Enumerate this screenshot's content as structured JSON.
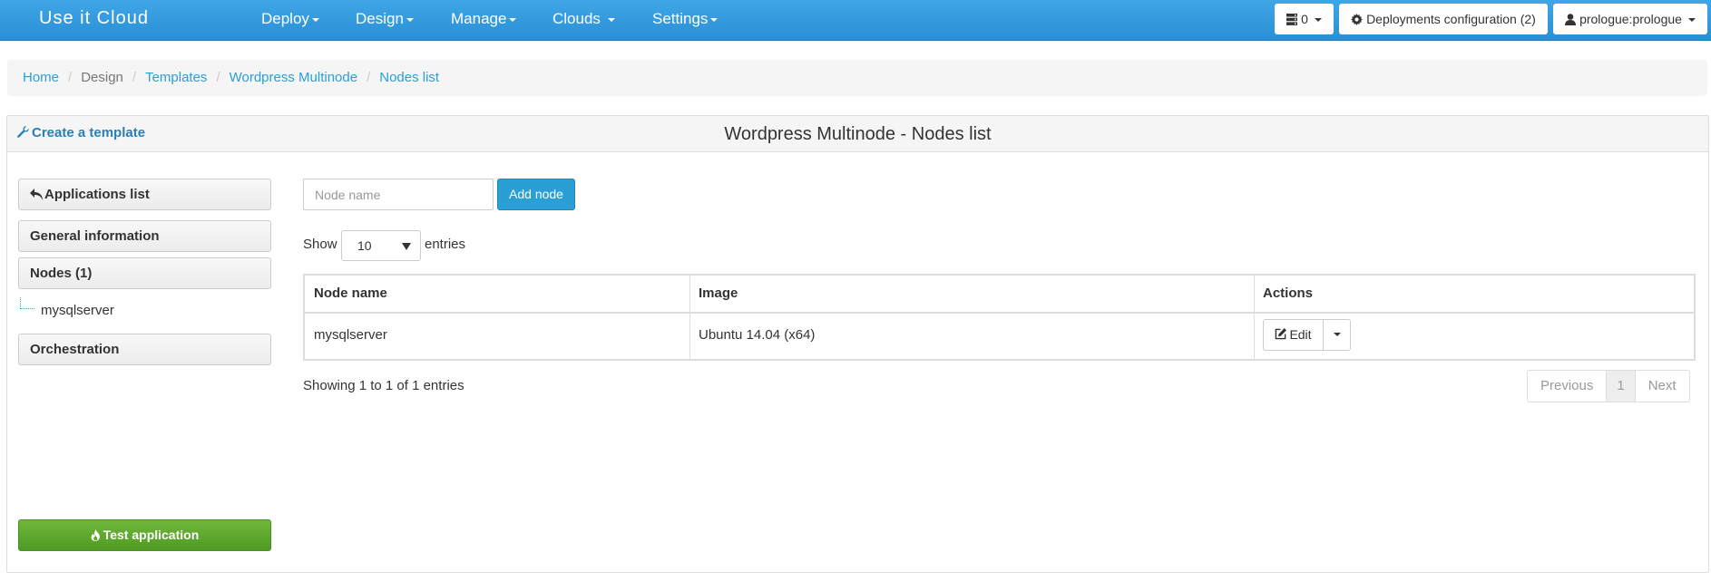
{
  "navbar": {
    "brand": "Use it Cloud",
    "menus": [
      "Deploy",
      "Design",
      "Manage",
      "Clouds",
      "Settings"
    ],
    "counter": "0",
    "deployments": "Deployments configuration (2)",
    "user": "prologue:prologue"
  },
  "breadcrumb": {
    "home": "Home",
    "design": "Design",
    "templates": "Templates",
    "app": "Wordpress Multinode",
    "current": "Nodes list",
    "separator": "/"
  },
  "panel": {
    "create_link": "Create a template",
    "title": "Wordpress Multinode - Nodes list"
  },
  "sidebar": {
    "applications_list": "Applications list",
    "general_information": "General information",
    "nodes": "Nodes (1)",
    "node_items": [
      "mysqlserver"
    ],
    "orchestration": "Orchestration",
    "test_application": "Test application"
  },
  "toolbar": {
    "node_name_placeholder": "Node name",
    "add_node": "Add node"
  },
  "length": {
    "show": "Show",
    "value": "10",
    "entries": "entries"
  },
  "table": {
    "headers": [
      "Node name",
      "Image",
      "Actions"
    ],
    "rows": [
      {
        "node_name": "mysqlserver",
        "image": "Ubuntu 14.04 (x64)",
        "action": "Edit"
      }
    ]
  },
  "footer": {
    "info": "Showing 1 to 1 of 1 entries",
    "previous": "Previous",
    "page": "1",
    "next": "Next"
  },
  "colors": {
    "navbar": "#2a9fd6",
    "link": "#2a9fd6",
    "success": "#5cb130"
  }
}
